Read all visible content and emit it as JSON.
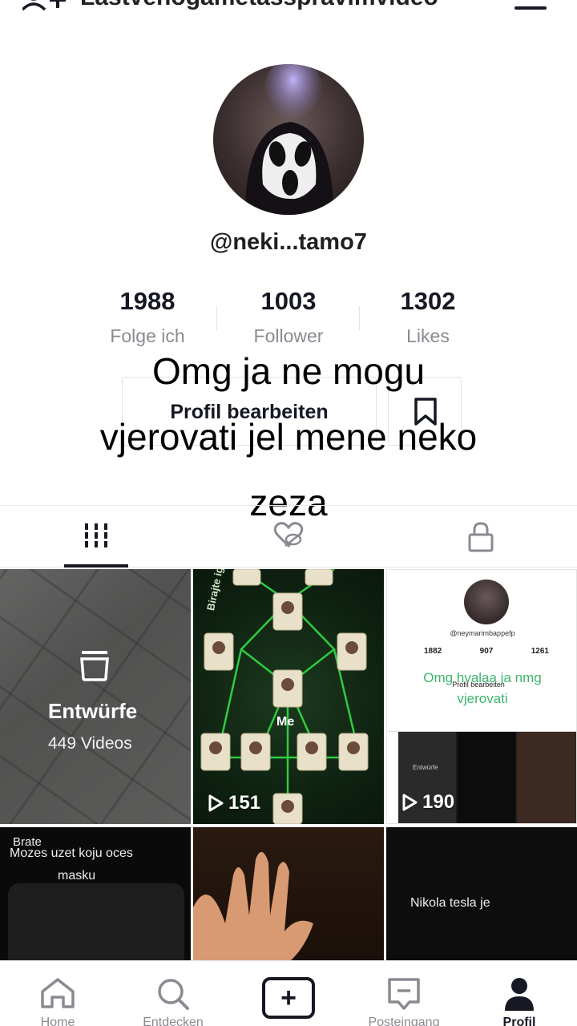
{
  "header": {
    "title": "Lastvenogametasspravimvideo",
    "add_user_icon": "add-user-icon",
    "menu_icon": "hamburger-icon"
  },
  "profile": {
    "username": "@neki...tamo7",
    "stats": [
      {
        "value": "1988",
        "label": "Folge ich"
      },
      {
        "value": "1003",
        "label": "Follower"
      },
      {
        "value": "1302",
        "label": "Likes"
      }
    ],
    "edit_button_label": "Profil bearbeiten",
    "bookmark_icon": "bookmark-icon"
  },
  "overlay_caption": {
    "lines": [
      "Omg ja ne mogu",
      "vjerovati jel mene neko",
      "zeza"
    ]
  },
  "tabs": [
    {
      "icon": "grid-icon",
      "active": true
    },
    {
      "icon": "hidden-likes-icon",
      "active": false
    },
    {
      "icon": "lock-icon",
      "active": false
    }
  ],
  "videos": {
    "drafts": {
      "label": "Entwürfe",
      "count": "449 Videos"
    },
    "tile2": {
      "views": "151",
      "me_label": "Me",
      "side_text": "Birajte igra"
    },
    "tile3": {
      "views": "190",
      "mini_username": "@neymarimbappefp",
      "mini_stats": [
        "1882",
        "907",
        "1261"
      ],
      "mini_caption": [
        "Omg hvalaa ja nmg",
        "vjerovati"
      ],
      "mini_edit": "Profil bearbeiten",
      "mini_drafts": "Entwürfe"
    },
    "tile4": {
      "line1": "Brate",
      "line2": "Mozes uzet koju oces",
      "line3": "masku"
    },
    "tile6": {
      "text": "Nikola tesla je"
    }
  },
  "bottom_nav": [
    {
      "label": "Home",
      "icon": "home-icon"
    },
    {
      "label": "Entdecken",
      "icon": "search-icon"
    },
    {
      "label": "",
      "icon": "create-icon"
    },
    {
      "label": "Posteingang",
      "icon": "inbox-icon"
    },
    {
      "label": "Profil",
      "icon": "profile-icon",
      "active": true
    }
  ]
}
